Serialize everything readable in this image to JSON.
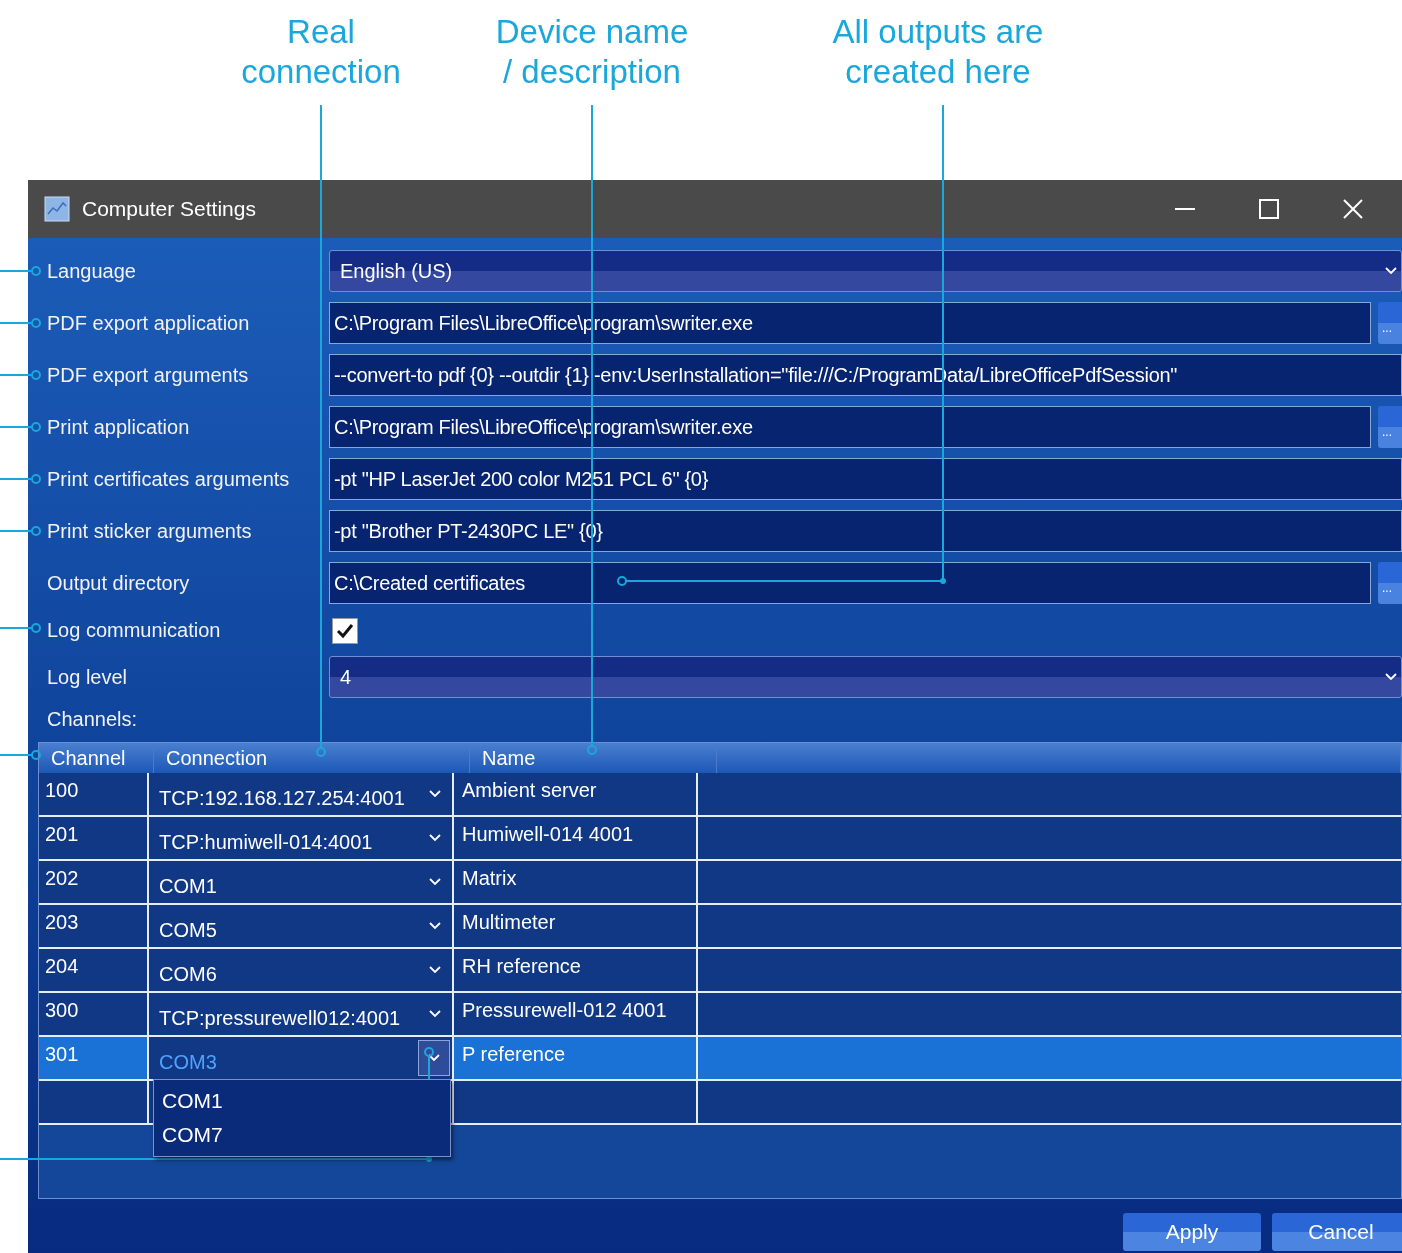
{
  "annotations": [
    {
      "lines": [
        "Real",
        "connection"
      ]
    },
    {
      "lines": [
        "Device name",
        "/ description"
      ]
    },
    {
      "lines": [
        "All outputs are",
        "created here"
      ]
    }
  ],
  "window": {
    "title": "Computer Settings"
  },
  "settings": [
    {
      "kind": "combo",
      "label": "Language",
      "value": "English (US)"
    },
    {
      "kind": "path",
      "label": "PDF export application",
      "value": "C:\\Program Files\\LibreOffice\\program\\swriter.exe",
      "browse": "..."
    },
    {
      "kind": "text",
      "label": "PDF export arguments",
      "value": "--convert-to pdf {0} --outdir {1}  -env:UserInstallation=\"file:///C:/ProgramData/LibreOfficePdfSession\""
    },
    {
      "kind": "path",
      "label": "Print application",
      "value": "C:\\Program Files\\LibreOffice\\program\\swriter.exe",
      "browse": "..."
    },
    {
      "kind": "text",
      "label": "Print certificates arguments",
      "value": "-pt \"HP LaserJet 200 color M251 PCL 6\" {0}"
    },
    {
      "kind": "text",
      "label": "Print sticker arguments",
      "value": "-pt \"Brother PT-2430PC LE\" {0}"
    },
    {
      "kind": "path",
      "label": "Output directory",
      "value": "C:\\Created certificates",
      "browse": "..."
    },
    {
      "kind": "checkbox",
      "label": "Log communication",
      "checked": true
    },
    {
      "kind": "combo",
      "label": "Log level",
      "value": "4"
    }
  ],
  "channels_label": "Channels:",
  "table": {
    "columns": [
      "Channel",
      "Connection",
      "Name"
    ],
    "rows": [
      {
        "channel": "100",
        "connection": "TCP:192.168.127.254:4001",
        "name": "Ambient server",
        "selected": false
      },
      {
        "channel": "201",
        "connection": "TCP:humiwell-014:4001",
        "name": "Humiwell-014 4001",
        "selected": false
      },
      {
        "channel": "202",
        "connection": "COM1",
        "name": "Matrix",
        "selected": false
      },
      {
        "channel": "203",
        "connection": "COM5",
        "name": "Multimeter",
        "selected": false
      },
      {
        "channel": "204",
        "connection": "COM6",
        "name": "RH reference",
        "selected": false
      },
      {
        "channel": "300",
        "connection": "TCP:pressurewell012:4001",
        "name": "Pressurewell-012 4001",
        "selected": false
      },
      {
        "channel": "301",
        "connection": "COM3",
        "name": "P reference",
        "selected": true
      }
    ],
    "dropdown_options": [
      "COM1",
      "COM7"
    ]
  },
  "buttons": [
    "Apply",
    "Cancel"
  ]
}
